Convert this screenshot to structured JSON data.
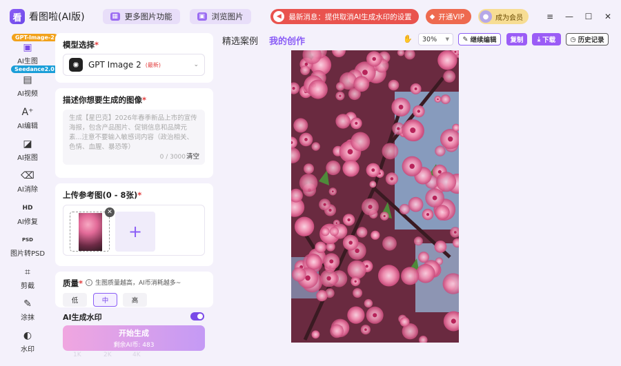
{
  "app": {
    "title": "看图啦(AI版)",
    "logo": "看"
  },
  "header": {
    "more_features": "更多图片功能",
    "browse_images": "浏览图片",
    "notice": "最新消息：提供取消AI生成水印的设置",
    "vip": "开通VIP",
    "member": "成为会员",
    "controls": [
      "≡",
      "—",
      "☐",
      "✕"
    ]
  },
  "sidebar": {
    "tag_gpt": "GPT-Image-2",
    "tag_seedance": "Seedance2.0",
    "items": [
      {
        "label": "AI生图",
        "icon": "image-gen-icon",
        "glyph": "▣"
      },
      {
        "label": "AI视频",
        "icon": "video-icon",
        "glyph": "▤"
      },
      {
        "label": "AI编辑",
        "icon": "ai-edit-icon",
        "glyph": "A⁺"
      },
      {
        "label": "AI抠图",
        "icon": "cutout-icon",
        "glyph": "◪"
      },
      {
        "label": "AI消除",
        "icon": "eraser-icon",
        "glyph": "⌫"
      },
      {
        "label": "AI修复",
        "icon": "hd-repair-icon",
        "glyph": "HD"
      },
      {
        "label": "图片转PSD",
        "icon": "psd-icon",
        "glyph": "PSD"
      },
      {
        "label": "剪截",
        "icon": "crop-icon",
        "glyph": "⌗"
      },
      {
        "label": "涂抹",
        "icon": "smear-icon",
        "glyph": "✎"
      },
      {
        "label": "水印",
        "icon": "watermark-icon",
        "glyph": "◐"
      }
    ]
  },
  "model": {
    "title": "模型选择",
    "name": "GPT Image 2",
    "badge": "(最新)"
  },
  "prompt": {
    "title": "描述你想要生成的图像",
    "placeholder": "生成【星巴克】2026年春季新品上市的宣传海报，包含产品图片、促销信息和品牌元素...注意不要输入敏感词内容（政治相关、色情、血腥、暴恐等）",
    "counter": "0 / 3000",
    "clear": "清空"
  },
  "upload": {
    "title": "上传参考图(0 - 8张)",
    "add": "+",
    "close": "✕"
  },
  "quality": {
    "title": "质量",
    "hint": "生图质量越高，AI币消耗越多~",
    "options": [
      "低",
      "中",
      "高"
    ],
    "selected": "中"
  },
  "watermark": {
    "label": "AI生成水印",
    "enabled": true
  },
  "generate": {
    "label": "开始生成",
    "sub": "剩余AI币: 483"
  },
  "ghost_labels": [
    "1K",
    "2K",
    "4K"
  ],
  "tabs": [
    "精选案例",
    "我的创作"
  ],
  "active_tab": "我的创作",
  "toolbar": {
    "zoom": "30%",
    "continue_edit": "继续编辑",
    "copy": "复制",
    "download": "下载",
    "history": "历史记录"
  },
  "colors": {
    "accent": "#8a5cf6",
    "notice_red": "#e9534e",
    "vip_orange": "#ee6a4f",
    "member_gold": "#f7dd94"
  }
}
